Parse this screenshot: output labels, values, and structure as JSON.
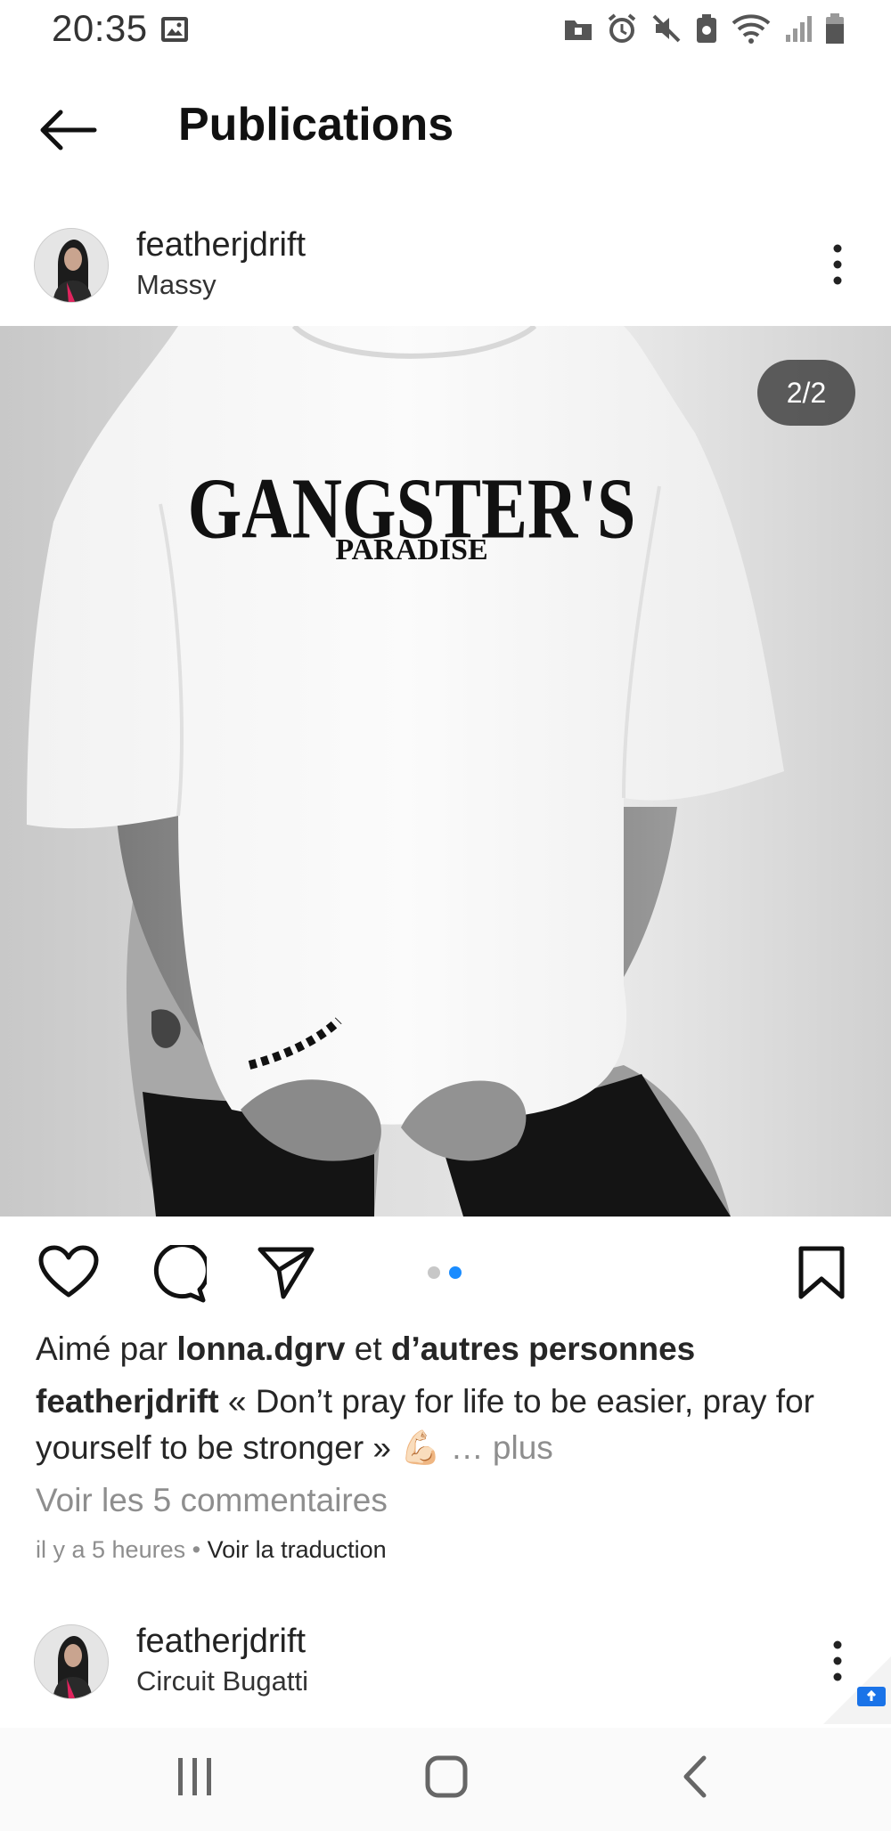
{
  "status_bar": {
    "time": "20:35"
  },
  "header": {
    "title": "Publications"
  },
  "post": {
    "username": "featherjdrift",
    "location": "Massy",
    "counter": "2/2",
    "shirt_print_line1": "GANGSTER'S",
    "shirt_print_line2": "PARADISE",
    "likes_prefix": "Aimé par ",
    "likes_user": "lonna.dgrv",
    "likes_middle": " et ",
    "likes_others": "d’autres personnes",
    "caption_user": "featherjdrift",
    "caption_text": " « Don’t pray for life to be easier, pray for yourself to be stronger » ",
    "caption_emoji": "💪🏻",
    "caption_more": " … plus",
    "comments_link": "Voir les 5 commentaires",
    "time_ago": "il y a 5 heures",
    "separator": " • ",
    "translate_link": "Voir la traduction",
    "carousel_total": 2,
    "carousel_active": 2
  },
  "next_post": {
    "username": "featherjdrift",
    "location": "Circuit Bugatti"
  },
  "colors": {
    "accent": "#1a8cff",
    "muted": "#8e8e8e",
    "text": "#262626"
  },
  "icons": {
    "back": "arrow-left-icon",
    "like": "heart-icon",
    "comment": "comment-bubble-icon",
    "share": "paper-plane-icon",
    "save": "bookmark-icon",
    "more": "vertical-dots-icon"
  }
}
